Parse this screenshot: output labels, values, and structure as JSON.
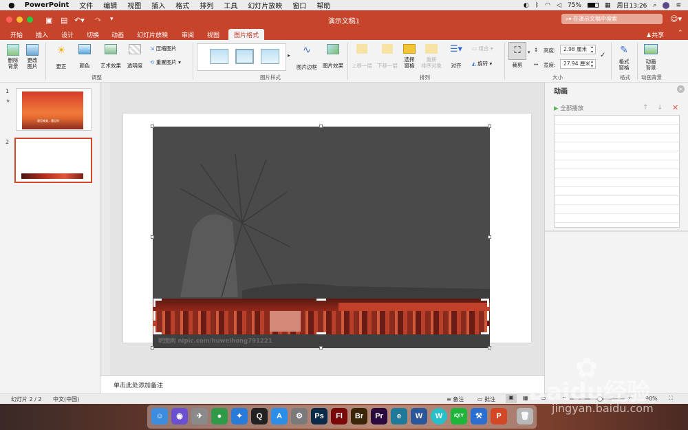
{
  "menubar": {
    "app_name": "PowerPoint",
    "items": [
      "文件",
      "编辑",
      "视图",
      "插入",
      "格式",
      "排列",
      "工具",
      "幻灯片放映",
      "窗口",
      "帮助"
    ],
    "battery": "75%",
    "clock": "周日13:26"
  },
  "titlebar": {
    "document_title": "演示文稿1",
    "search_placeholder": "在演示文稿中搜索"
  },
  "tabs": [
    {
      "label": "开始"
    },
    {
      "label": "插入"
    },
    {
      "label": "设计"
    },
    {
      "label": "切换"
    },
    {
      "label": "动画"
    },
    {
      "label": "幻灯片放映"
    },
    {
      "label": "审阅"
    },
    {
      "label": "视图"
    },
    {
      "label": "图片格式",
      "active": true
    }
  ],
  "share_label": "共享",
  "ribbon": {
    "remove_bg": [
      "删除",
      "背景"
    ],
    "change_pic": [
      "更改",
      "图片"
    ],
    "corrections": "更正",
    "color": "颜色",
    "artistic": "艺术效果",
    "transparency": "透明度",
    "compress": "压缩图片",
    "reset": "重置图片",
    "group_adjust": "调整",
    "picture_border": "图片边框",
    "picture_effects": "图片效果",
    "group_styles": "图片样式",
    "bring_forward": "上移一层",
    "send_backward": "下移一层",
    "selection_pane": [
      "选择",
      "窗格"
    ],
    "reorder": [
      "重新",
      "排序对象"
    ],
    "align": "对齐",
    "group": "组合",
    "rotate": "旋转",
    "group_arrange": "排列",
    "crop": "裁剪",
    "height_label": "高度:",
    "height_value": "2.98 厘米",
    "width_label": "宽度:",
    "width_value": "27.94 厘米",
    "group_size": "大小",
    "format_pane": [
      "格式",
      "窗格"
    ],
    "group_format": "格式",
    "anim_bg": [
      "动画",
      "背景"
    ],
    "group_anim_bg": "动画背景"
  },
  "thumbnails": [
    {
      "number": "1",
      "star": "★",
      "caption": "遇见唯美，遇见你"
    },
    {
      "number": "2",
      "star": ""
    }
  ],
  "slide_image": {
    "watermark": "昵图网 nipic.com/huweihong791221"
  },
  "notes_placeholder": "单击此处添加备注",
  "animation_pane": {
    "title": "动画",
    "play_all": "全部播放"
  },
  "statusbar": {
    "slide_info": "幻灯片 2 / 2",
    "language": "中文(中国)",
    "notes_btn": "备注",
    "comments_btn": "批注",
    "zoom_level": "90%",
    "zoom_fraction": 0.55
  },
  "dock": [
    {
      "name": "finder",
      "label": "☺",
      "color": "#3c8de0"
    },
    {
      "name": "siri",
      "label": "◉",
      "color": "#6a4fd0"
    },
    {
      "name": "launchpad",
      "label": "✈",
      "color": "#8a8a8a"
    },
    {
      "name": "chrome",
      "label": "●",
      "color": "#2f9a48"
    },
    {
      "name": "safari",
      "label": "✦",
      "color": "#2a7bd8"
    },
    {
      "name": "qq",
      "label": "Q",
      "color": "#222222"
    },
    {
      "name": "app-store",
      "label": "A",
      "color": "#2b8fe8"
    },
    {
      "name": "system-preferences",
      "label": "⚙",
      "color": "#7a7a7a"
    },
    {
      "name": "photoshop",
      "label": "Ps",
      "color": "#0b2a48"
    },
    {
      "name": "flash",
      "label": "Fl",
      "color": "#7a0a0a"
    },
    {
      "name": "bridge",
      "label": "Br",
      "color": "#3a2508"
    },
    {
      "name": "premiere",
      "label": "Pr",
      "color": "#2a0a3c"
    },
    {
      "name": "browser",
      "label": "e",
      "color": "#1f7a9a"
    },
    {
      "name": "word",
      "label": "W",
      "color": "#2b579a"
    },
    {
      "name": "wps",
      "label": "W",
      "color": "#28c0c8"
    },
    {
      "name": "iqiyi",
      "label": "iQIY",
      "color": "#1fb53a"
    },
    {
      "name": "xcode",
      "label": "⚒",
      "color": "#2a6fd0"
    },
    {
      "name": "powerpoint",
      "label": "P",
      "color": "#d24726"
    },
    {
      "name": "trash",
      "label": "🗑",
      "color": "#b8b8b8"
    }
  ],
  "watermark_brand": "Baidu经验",
  "watermark_url": "jingyan.baidu.com"
}
